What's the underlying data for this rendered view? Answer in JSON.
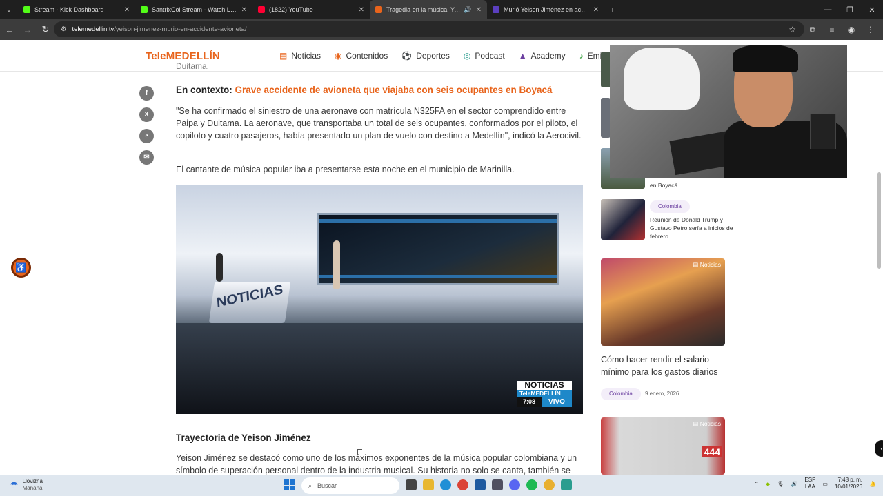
{
  "browser": {
    "tabs": [
      {
        "title": "Stream - Kick Dashboard",
        "color": "#53fc18"
      },
      {
        "title": "SantrixCol Stream - Watch Live",
        "color": "#53fc18"
      },
      {
        "title": "(1822) YouTube",
        "color": "#ff0033"
      },
      {
        "title": "Tragedia en la música: Yeis",
        "color": "#e8641c"
      },
      {
        "title": "Murió Yeison Jiménez en accide",
        "color": "#5b3fbf"
      }
    ],
    "active_tab": 3,
    "url_host": "telemedellin.tv",
    "url_path": "/yeison-jimenez-murio-en-accidente-avioneta/"
  },
  "site": {
    "logo": "TeleMEDELLÍN",
    "nav": [
      "Noticias",
      "Contenidos",
      "Deportes",
      "Podcast",
      "Academy",
      "Emisor"
    ]
  },
  "article": {
    "cut_text": "Duitama.",
    "context_prefix": "En contexto:",
    "context_link": "Grave accidente de avioneta que viajaba con seis ocupantes en Boyacá",
    "paragraph1": "\"Se ha confirmado el siniestro de una aeronave con matrícula N325FA en el sector comprendido entre Paipa y Duitama. La aeronave, que transportaba un total de seis ocupantes, conformados por el piloto, el copiloto y cuatro pasajeros, había presentado un plan de vuelo con destino a Medellín\", indicó la Aerocivil.",
    "paragraph2": "El cantante de música popular iba a presentarse esta noche en el municipio de Marinilla.",
    "video": {
      "desk_text": "NOTICIAS",
      "badge_top": "NOTICIAS",
      "badge_brand": "TeleMEDELLÍN",
      "badge_time": "7:08",
      "badge_live": "VIVO"
    },
    "subheading": "Trayectoria de Yeison Jiménez",
    "paragraph3": "Yeison Jiménez  se destacó como uno de los máximos exponentes de la música popular colombiana y un símbolo de superación personal dentro de la industria musical. Su historia no solo se canta, también se"
  },
  "sidebar": {
    "partial_title": "en Boyacá",
    "item_trump": {
      "category": "Colombia",
      "title": "Reunión de Donald Trump y Gustavo Petro sería a inicios de febrero"
    },
    "card1": {
      "tag": "Noticias",
      "title": "Cómo hacer rendir el salario mínimo para los gastos diarios",
      "category": "Colombia",
      "date": "9 enero, 2026"
    },
    "card2": {
      "tag": "Noticias",
      "sign": "444"
    }
  },
  "taskbar": {
    "weather_title": "Llovizna",
    "weather_sub": "Mañana",
    "search_placeholder": "Buscar",
    "lang_top": "ESP",
    "lang_bottom": "LAA",
    "time": "7:48 p. m.",
    "date": "10/01/2026"
  }
}
